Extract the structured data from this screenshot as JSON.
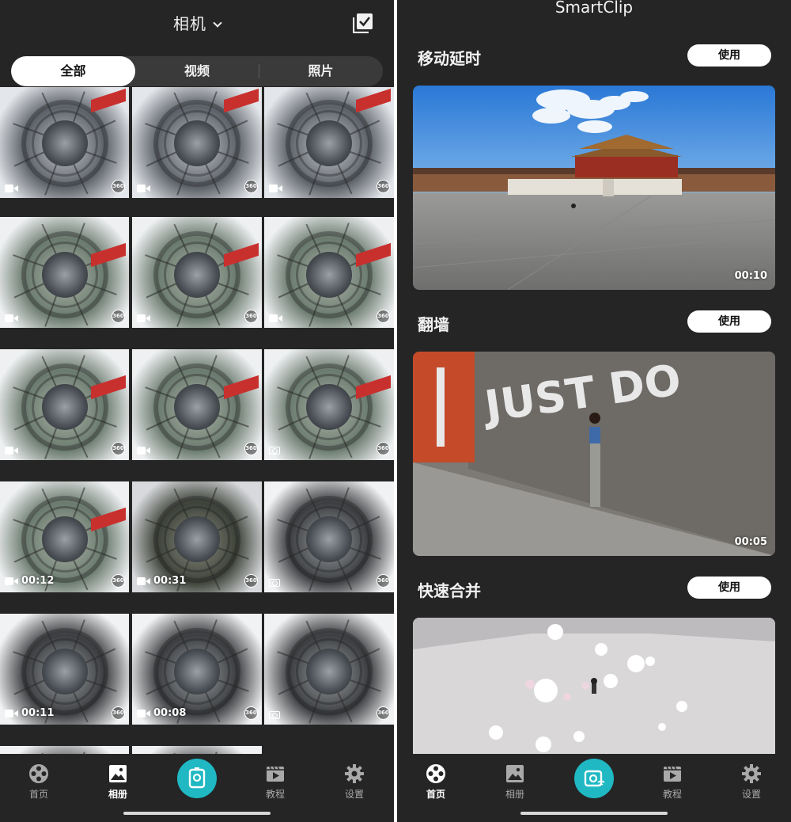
{
  "left": {
    "header": {
      "title": "相机"
    },
    "tabs": [
      {
        "label": "全部",
        "active": true
      },
      {
        "label": "视频",
        "active": false
      },
      {
        "label": "照片",
        "active": false
      }
    ],
    "grid": [
      {
        "kind": "video",
        "duration": "",
        "badge": "360",
        "style": "stairs"
      },
      {
        "kind": "video",
        "duration": "",
        "badge": "360",
        "style": "stairs"
      },
      {
        "kind": "video",
        "duration": "",
        "badge": "360",
        "style": "stairs"
      },
      {
        "kind": "video",
        "duration": "",
        "badge": "360",
        "style": "plaza"
      },
      {
        "kind": "video",
        "duration": "",
        "badge": "360",
        "style": "plaza"
      },
      {
        "kind": "video",
        "duration": "",
        "badge": "360",
        "style": "plaza"
      },
      {
        "kind": "video",
        "duration": "",
        "badge": "360",
        "style": "plaza"
      },
      {
        "kind": "video",
        "duration": "",
        "badge": "360",
        "style": "plaza"
      },
      {
        "kind": "photo",
        "duration": "",
        "badge": "360",
        "style": "plaza"
      },
      {
        "kind": "video",
        "duration": "00:12",
        "badge": "360",
        "style": "plaza"
      },
      {
        "kind": "video",
        "duration": "00:31",
        "badge": "360",
        "style": "dark"
      },
      {
        "kind": "photo",
        "duration": "",
        "badge": "360",
        "style": "street"
      },
      {
        "kind": "video",
        "duration": "00:11",
        "badge": "360",
        "style": "street"
      },
      {
        "kind": "video",
        "duration": "00:08",
        "badge": "360",
        "style": "street"
      },
      {
        "kind": "photo",
        "duration": "",
        "badge": "360",
        "style": "street"
      },
      {
        "kind": "none",
        "duration": "",
        "badge": "",
        "style": "street"
      },
      {
        "kind": "none",
        "duration": "",
        "badge": "",
        "style": "street"
      }
    ],
    "nav": [
      {
        "label": "首页",
        "icon": "film-reel-icon",
        "active": false
      },
      {
        "label": "相册",
        "icon": "album-icon",
        "active": true
      },
      {
        "label": "",
        "icon": "capture-icon",
        "active": false
      },
      {
        "label": "教程",
        "icon": "tutorial-icon",
        "active": false
      },
      {
        "label": "设置",
        "icon": "gear-icon",
        "active": false
      }
    ]
  },
  "right": {
    "header": {
      "title": "SmartClip"
    },
    "sections": [
      {
        "title": "移动延时",
        "button": "使用",
        "duration": "00:10",
        "scene": "palace"
      },
      {
        "title": "翻墙",
        "button": "使用",
        "duration": "00:05",
        "scene": "wall",
        "wall_text": "JUST DO"
      },
      {
        "title": "快速合并",
        "button": "使用",
        "duration": "",
        "scene": "bubbles"
      }
    ],
    "nav": [
      {
        "label": "首页",
        "icon": "film-reel-icon",
        "active": true
      },
      {
        "label": "相册",
        "icon": "album-icon",
        "active": false
      },
      {
        "label": "",
        "icon": "capture-wifi-icon",
        "active": false
      },
      {
        "label": "教程",
        "icon": "tutorial-icon",
        "active": false
      },
      {
        "label": "设置",
        "icon": "gear-icon",
        "active": false
      }
    ]
  },
  "colors": {
    "background": "#252525",
    "accent": "#1fb8c3",
    "tab_bg": "#3a3a3a",
    "tab_active": "#ffffff"
  }
}
